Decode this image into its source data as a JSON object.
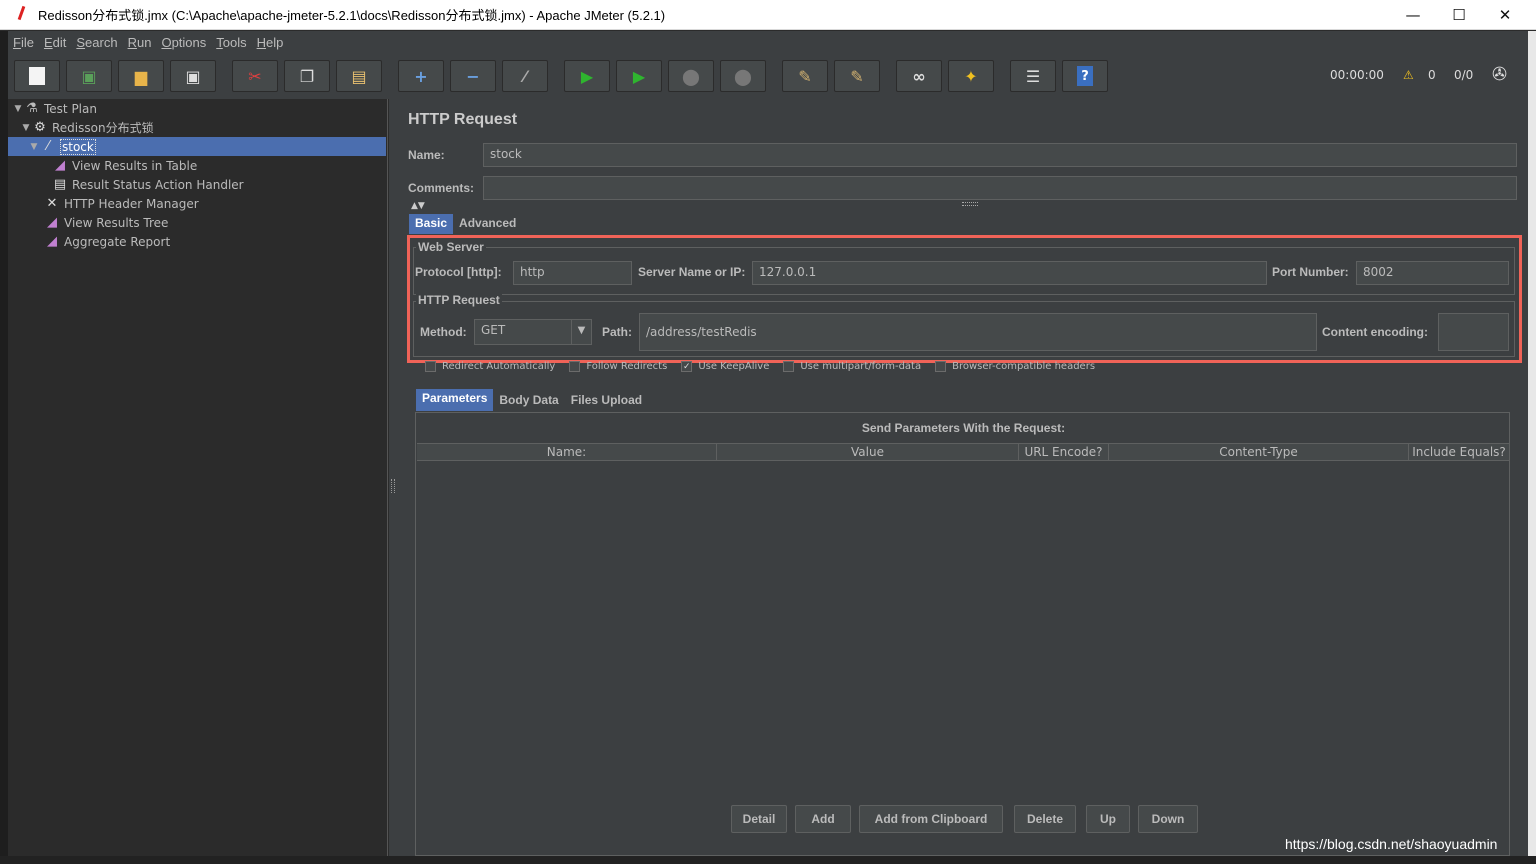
{
  "window": {
    "title": "Redisson分布式锁.jmx (C:\\Apache\\apache-jmeter-5.2.1\\docs\\Redisson分布式锁.jmx) - Apache JMeter (5.2.1)",
    "min": "—",
    "max": "☐",
    "close": "✕"
  },
  "menu": [
    {
      "first": "F",
      "rest": "ile"
    },
    {
      "first": "E",
      "rest": "dit"
    },
    {
      "first": "S",
      "rest": "earch"
    },
    {
      "first": "R",
      "rest": "un"
    },
    {
      "first": "O",
      "rest": "ptions"
    },
    {
      "first": "T",
      "rest": "ools"
    },
    {
      "first": "H",
      "rest": "elp"
    }
  ],
  "toolbar": {
    "timer": "00:00:00",
    "warnings": "0",
    "threads": "0/0"
  },
  "tree": [
    {
      "label": "Test Plan",
      "icon": "test-plan-icon"
    },
    {
      "label": "Redisson分布式锁",
      "icon": "thread-group-icon"
    },
    {
      "label": "stock",
      "icon": "http-sampler-icon"
    },
    {
      "label": "View Results in Table",
      "icon": "listener-icon"
    },
    {
      "label": "Result Status Action Handler",
      "icon": "document-icon"
    },
    {
      "label": "HTTP Header Manager",
      "icon": "tools-icon"
    },
    {
      "label": "View Results Tree",
      "icon": "listener-icon"
    },
    {
      "label": "Aggregate Report",
      "icon": "listener-icon"
    }
  ],
  "panel": {
    "title": "HTTP Request",
    "name_label": "Name:",
    "name_value": "stock",
    "comments_label": "Comments:",
    "comments_value": "",
    "tabs": [
      "Basic",
      "Advanced"
    ],
    "web_server": {
      "title": "Web Server",
      "protocol_label": "Protocol [http]:",
      "protocol_value": "http",
      "server_label": "Server Name or IP:",
      "server_value": "127.0.0.1",
      "port_label": "Port Number:",
      "port_value": "8002"
    },
    "http_request": {
      "title": "HTTP Request",
      "method_label": "Method:",
      "method_value": "GET",
      "path_label": "Path:",
      "path_value": "/address/testRedis",
      "encoding_label": "Content encoding:",
      "encoding_value": ""
    },
    "checkboxes": [
      {
        "label": "Redirect Automatically",
        "checked": false
      },
      {
        "label": "Follow Redirects",
        "checked": false
      },
      {
        "label": "Use KeepAlive",
        "checked": true
      },
      {
        "label": "Use multipart/form-data",
        "checked": false
      },
      {
        "label": "Browser-compatible headers",
        "checked": false
      }
    ],
    "sub_tabs": [
      "Parameters",
      "Body Data",
      "Files Upload"
    ],
    "params_title": "Send Parameters With the Request:",
    "columns": [
      "Name:",
      "Value",
      "URL Encode?",
      "Content-Type",
      "Include Equals?"
    ],
    "buttons": [
      "Detail",
      "Add",
      "Add from Clipboard",
      "Delete",
      "Up",
      "Down"
    ]
  },
  "watermark": "https://blog.csdn.net/shaoyuadmin"
}
